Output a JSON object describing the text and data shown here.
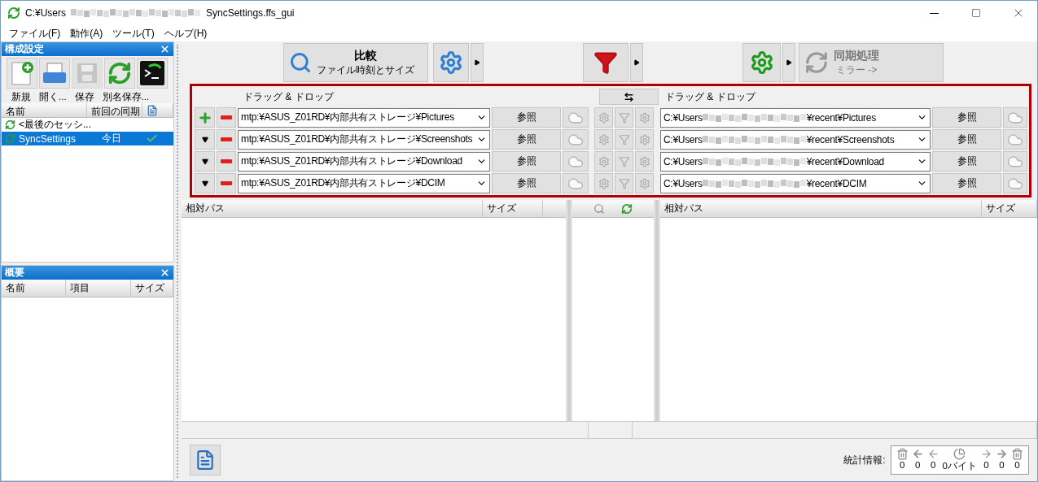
{
  "window": {
    "title_prefix": "C:¥Users",
    "title_suffix": "SyncSettings.ffs_gui"
  },
  "menu": [
    "ファイル(F)",
    "動作(A)",
    "ツール(T)",
    "ヘルプ(H)"
  ],
  "config_panel": {
    "title": "構成設定",
    "tools": [
      {
        "kind": "new",
        "disabled": false
      },
      {
        "kind": "open",
        "disabled": false
      },
      {
        "kind": "save",
        "disabled": true
      },
      {
        "kind": "saveas",
        "disabled": false
      },
      {
        "kind": "batch",
        "disabled": false
      }
    ],
    "tool_labels": [
      "新規",
      "開く...",
      "保存",
      "別名保存..."
    ],
    "columns": [
      "名前",
      "前回の同期"
    ],
    "rows": [
      {
        "name": "<最後のセッシ...",
        "selected": false,
        "synced": false
      },
      {
        "name": "SyncSettings",
        "last_sync": "今日",
        "selected": true,
        "synced": true
      }
    ]
  },
  "overview": {
    "title": "概要",
    "columns": [
      "名前",
      "項目",
      "サイズ"
    ]
  },
  "toolbar": {
    "compare_title": "比較",
    "compare_subtitle": "ファイル時刻とサイズ",
    "sync_title": "同期処理",
    "sync_subtitle": "ミラー ->",
    "sync_disabled": true
  },
  "folder_pairs": {
    "left_header": "ドラッグ & ドロップ",
    "right_header": "ドラッグ & ドロップ",
    "rows": [
      {
        "kind": "add",
        "left_path": "mtp:¥ASUS_Z01RD¥内部共有ストレージ¥Pictures",
        "right_start": "C:¥Users",
        "right_end": "¥recent¥Pictures",
        "browse_left": "参照",
        "browse_right": "参照"
      },
      {
        "kind": "expand",
        "left_path": "mtp:¥ASUS_Z01RD¥内部共有ストレージ¥Screenshots",
        "right_start": "C:¥Users",
        "right_end": "¥recent¥Screenshots",
        "browse_left": "参照",
        "browse_right": "参照"
      },
      {
        "kind": "expand",
        "left_path": "mtp:¥ASUS_Z01RD¥内部共有ストレージ¥Download",
        "right_start": "C:¥Users",
        "right_end": "¥recent¥Download",
        "browse_left": "参照",
        "browse_right": "参照"
      },
      {
        "kind": "expand",
        "left_path": "mtp:¥ASUS_Z01RD¥内部共有ストレージ¥DCIM",
        "right_start": "C:¥Users",
        "right_end": "¥recent¥DCIM",
        "browse_left": "参照",
        "browse_right": "参照"
      }
    ]
  },
  "grid": {
    "left_columns": [
      "相対パス",
      "サイズ"
    ],
    "right_columns": [
      "相対パス",
      "サイズ"
    ]
  },
  "statistics": {
    "label": "統計情報:",
    "values": [
      "0",
      "0",
      "0",
      "0バイト",
      "0",
      "0",
      "0"
    ]
  }
}
